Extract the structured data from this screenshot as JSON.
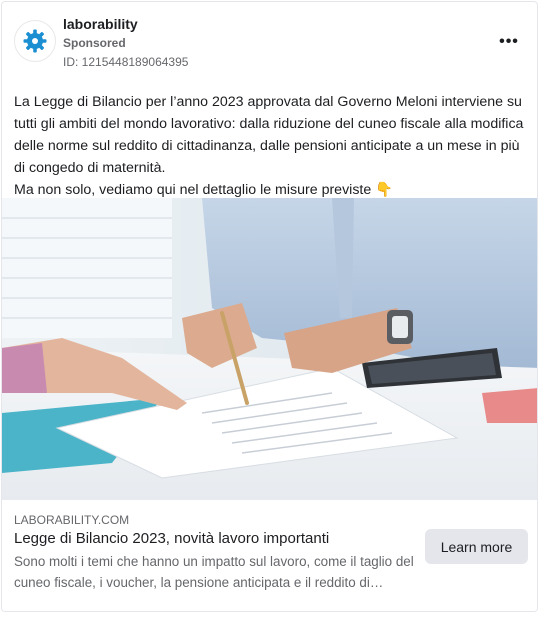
{
  "advertiser": {
    "name": "laborability",
    "sponsored_label": "Sponsored",
    "ad_id": "ID: 1215448189064395",
    "more_label": "•••"
  },
  "post": {
    "line1": "La Legge di Bilancio per l’anno 2023 approvata dal Governo Meloni interviene su tutti gli ambiti del mondo lavorativo: dalla riduzione del cuneo fiscale alla modifica delle norme sul reddito di cittadinanza, dalle pensioni anticipate a un mese in più di congedo di maternità.",
    "line2": "Ma non solo, vediamo qui nel dettaglio le misure previste 👇"
  },
  "link": {
    "domain": "LABORABILITY.COM",
    "headline": "Legge di Bilancio 2023, novità lavoro importanti",
    "description": "Sono molti i temi che hanno un impatto sul lavoro, come il taglio del cuneo fiscale, i voucher, la pensione anticipata e il reddito di cittadinanza.",
    "cta_label": "Learn more"
  },
  "icons": {
    "avatar": "gear-badge-icon",
    "more": "more-options-icon"
  },
  "colors": {
    "brand": "#1b8fd1",
    "cta_bg": "#e4e6eb",
    "secondary_text": "#65676b"
  }
}
